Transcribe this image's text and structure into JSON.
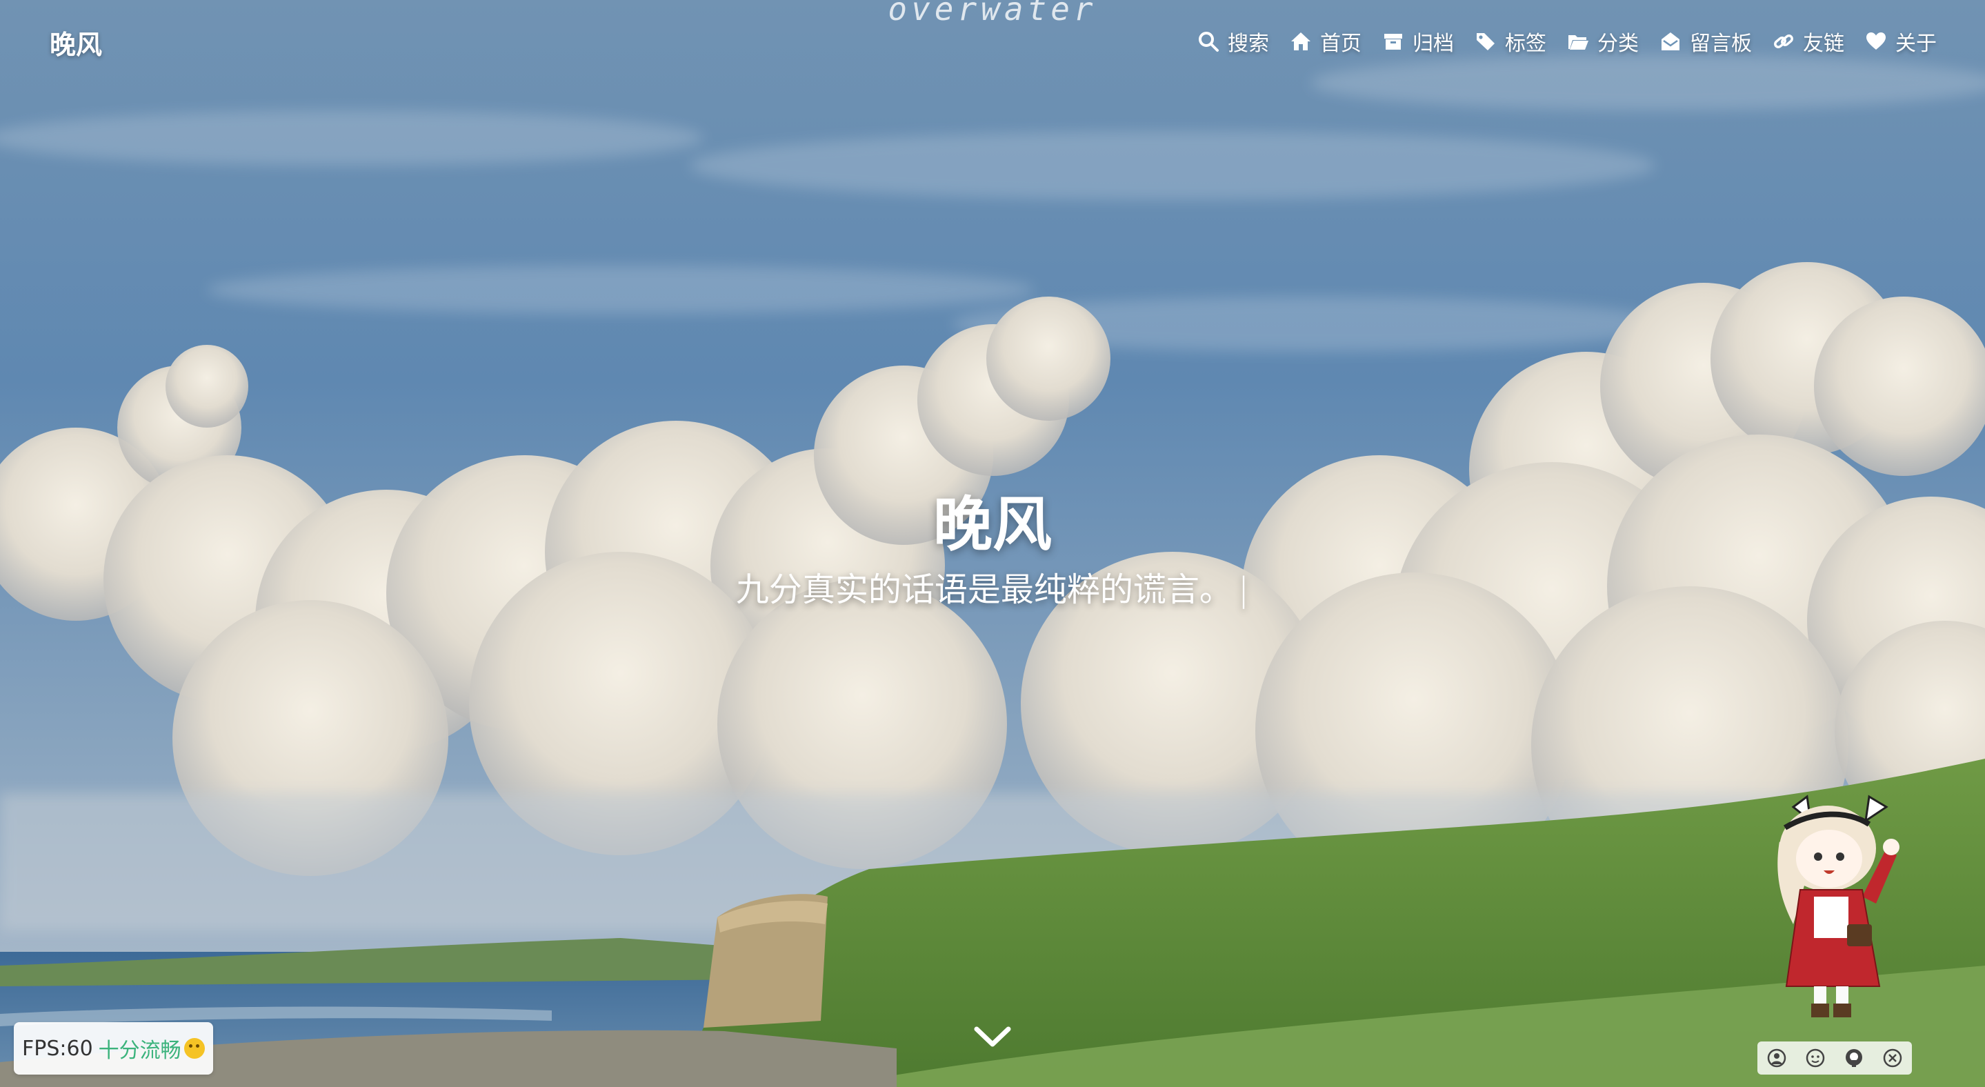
{
  "site": {
    "name": "晚风",
    "watermark": "overwater"
  },
  "nav": [
    {
      "icon": "search-icon",
      "label": "搜索"
    },
    {
      "icon": "home-icon",
      "label": "首页"
    },
    {
      "icon": "archive-icon",
      "label": "归档"
    },
    {
      "icon": "tag-icon",
      "label": "标签"
    },
    {
      "icon": "folder-icon",
      "label": "分类"
    },
    {
      "icon": "message-board-icon",
      "label": "留言板"
    },
    {
      "icon": "link-icon",
      "label": "友链"
    },
    {
      "icon": "heart-icon",
      "label": "关于"
    }
  ],
  "hero": {
    "title": "晚风",
    "subtitle": "九分真实的话语是最纯粹的谎言。",
    "caret": "|"
  },
  "fps": {
    "label": "FPS:60",
    "status": "十分流畅",
    "emoji_icon": "grin-emoji-icon"
  },
  "widget": {
    "tools": [
      "user-icon",
      "face-switch-icon",
      "github-icon",
      "close-icon"
    ]
  },
  "colors": {
    "sky": "#6d93b6",
    "grass": "#5f8e3d",
    "sea": "#4f78a3",
    "accent": "#3bb37c"
  }
}
